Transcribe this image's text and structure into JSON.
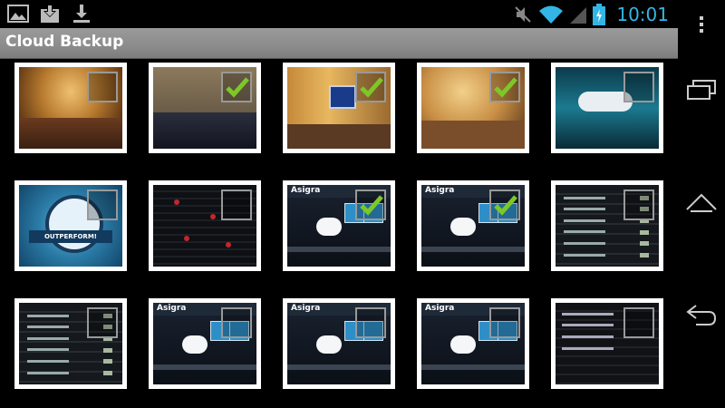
{
  "status_bar": {
    "notification_icons": [
      "gallery-icon",
      "download-to-tray-icon",
      "download-icon"
    ],
    "system_icons": [
      "mute-icon",
      "wifi-icon",
      "signal-icon",
      "battery-charging-icon"
    ],
    "time": "10:01",
    "clock_color": "#33b5e5"
  },
  "action_bar": {
    "title": "Cloud Backup"
  },
  "grid": {
    "rows": 3,
    "columns": 5,
    "items": [
      {
        "content": "conference-room-photo",
        "selected": false
      },
      {
        "content": "conference-hall-photo",
        "selected": true
      },
      {
        "content": "conference-stage-photo",
        "selected": true
      },
      {
        "content": "conference-room-photo",
        "selected": true
      },
      {
        "content": "presentation-slide-photo",
        "selected": false
      },
      {
        "content": "outperform-logo-image",
        "selected": false
      },
      {
        "content": "dark-app-screenshot",
        "selected": false
      },
      {
        "content": "asigra-app-screenshot",
        "selected": true
      },
      {
        "content": "asigra-app-screenshot",
        "selected": true
      },
      {
        "content": "settings-list-screenshot",
        "selected": false
      },
      {
        "content": "settings-list-screenshot",
        "selected": false
      },
      {
        "content": "asigra-app-screenshot",
        "selected": false
      },
      {
        "content": "asigra-app-screenshot",
        "selected": false
      },
      {
        "content": "asigra-app-screenshot",
        "selected": false
      },
      {
        "content": "file-list-screenshot",
        "selected": false
      }
    ]
  },
  "thumbnail_text": {
    "asigra_brand": "Asigra",
    "logo_banner": "OUTPERFORM!"
  },
  "nav_bar": {
    "buttons": [
      "menu-icon",
      "recent-apps-icon",
      "home-icon",
      "back-icon"
    ]
  },
  "colors": {
    "checkmark": "#7cc828",
    "action_bar": "#8f8f8f",
    "background": "#000000"
  }
}
